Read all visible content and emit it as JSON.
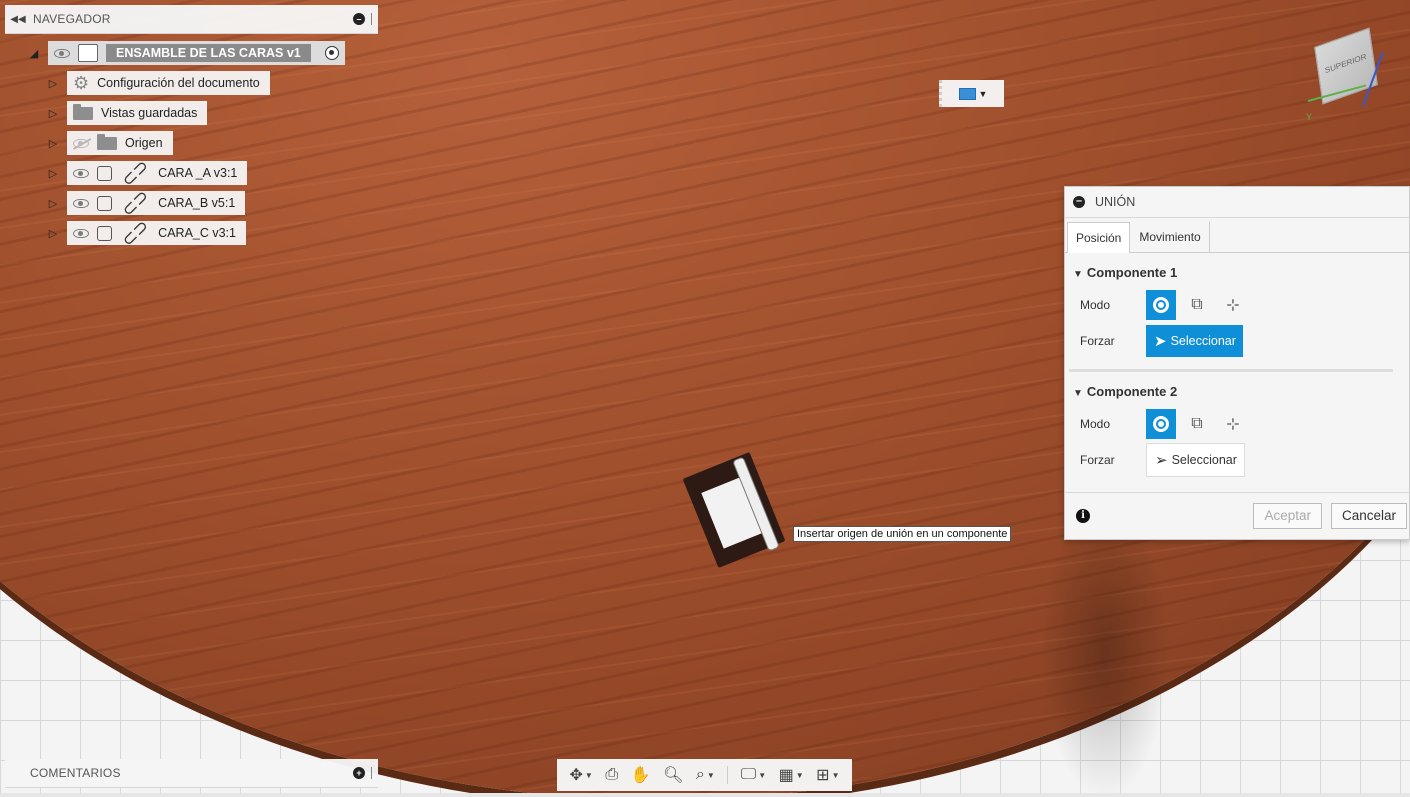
{
  "navigator": {
    "title": "NAVEGADOR",
    "root": {
      "label": "ENSAMBLE DE LAS CARAS v1"
    },
    "items": [
      {
        "label": "Configuración del documento"
      },
      {
        "label": "Vistas guardadas"
      },
      {
        "label": "Origen"
      },
      {
        "label": "CARA _A v3:1"
      },
      {
        "label": "CARA_B v5:1"
      },
      {
        "label": "CARA_C v3:1"
      }
    ]
  },
  "comments": {
    "title": "COMENTARIOS"
  },
  "viewcube": {
    "face_label": "SUPERIOR",
    "axis_y": "Y"
  },
  "tooltip": {
    "text": "Insertar origen de unión en un componente"
  },
  "union_dialog": {
    "title": "UNIÓN",
    "tabs": [
      {
        "label": "Posición"
      },
      {
        "label": "Movimiento"
      }
    ],
    "component1": {
      "title": "Componente 1",
      "mode_label": "Modo",
      "force_label": "Forzar",
      "select_label": "Seleccionar"
    },
    "component2": {
      "title": "Componente 2",
      "mode_label": "Modo",
      "force_label": "Forzar",
      "select_label": "Seleccionar"
    },
    "accept_label": "Aceptar",
    "cancel_label": "Cancelar"
  },
  "colors": {
    "accent": "#0f8fd8",
    "wood": "#a0502d"
  }
}
